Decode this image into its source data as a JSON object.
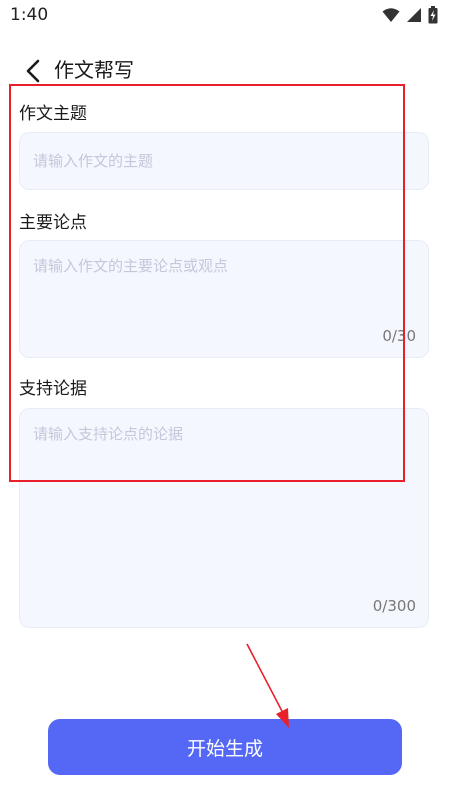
{
  "status_bar": {
    "time": "1:40",
    "icons": [
      "wifi-icon",
      "signal-icon",
      "battery-icon"
    ]
  },
  "header": {
    "title": "作文帮写",
    "back_icon": "chevron-left-icon"
  },
  "form": {
    "topic": {
      "label": "作文主题",
      "placeholder": "请输入作文的主题",
      "value": ""
    },
    "main_points": {
      "label": "主要论点",
      "placeholder": "请输入作文的主要论点或观点",
      "value": "",
      "counter": "0/30"
    },
    "evidence": {
      "label": "支持论据",
      "placeholder": "请输入支持论点的论据",
      "value": "",
      "counter": "0/300"
    }
  },
  "submit": {
    "label": "开始生成"
  },
  "colors": {
    "accent": "#5468f5",
    "field_bg": "#f5f7fe",
    "annotation_red": "#e8202a"
  }
}
